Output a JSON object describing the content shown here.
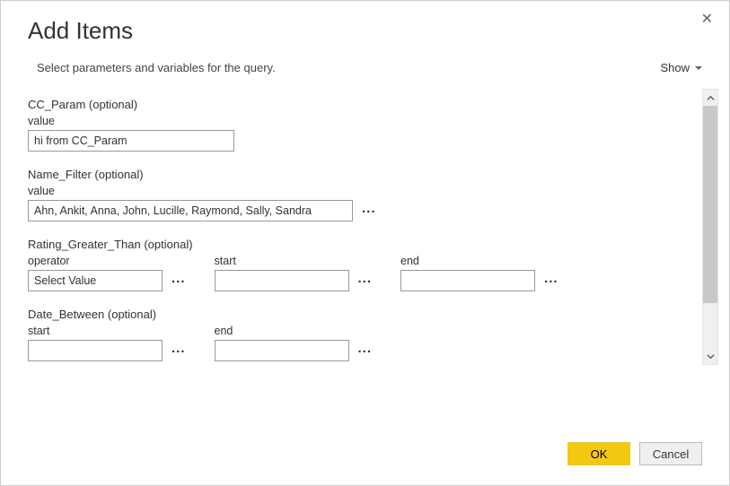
{
  "dialog": {
    "title": "Add Items",
    "subtitle": "Select parameters and variables for the query.",
    "show_label": "Show"
  },
  "params": {
    "cc_param": {
      "title": "CC_Param (optional)",
      "label": "value",
      "value": "hi from CC_Param"
    },
    "name_filter": {
      "title": "Name_Filter (optional)",
      "label": "value",
      "value": "Ahn, Ankit, Anna, John, Lucille, Raymond, Sally, Sandra"
    },
    "rating_gt": {
      "title": "Rating_Greater_Than (optional)",
      "operator_label": "operator",
      "operator_value": "Select Value",
      "start_label": "start",
      "start_value": "",
      "end_label": "end",
      "end_value": ""
    },
    "date_between": {
      "title": "Date_Between (optional)",
      "start_label": "start",
      "start_value": "",
      "end_label": "end",
      "end_value": ""
    }
  },
  "buttons": {
    "ok": "OK",
    "cancel": "Cancel"
  },
  "more": "..."
}
